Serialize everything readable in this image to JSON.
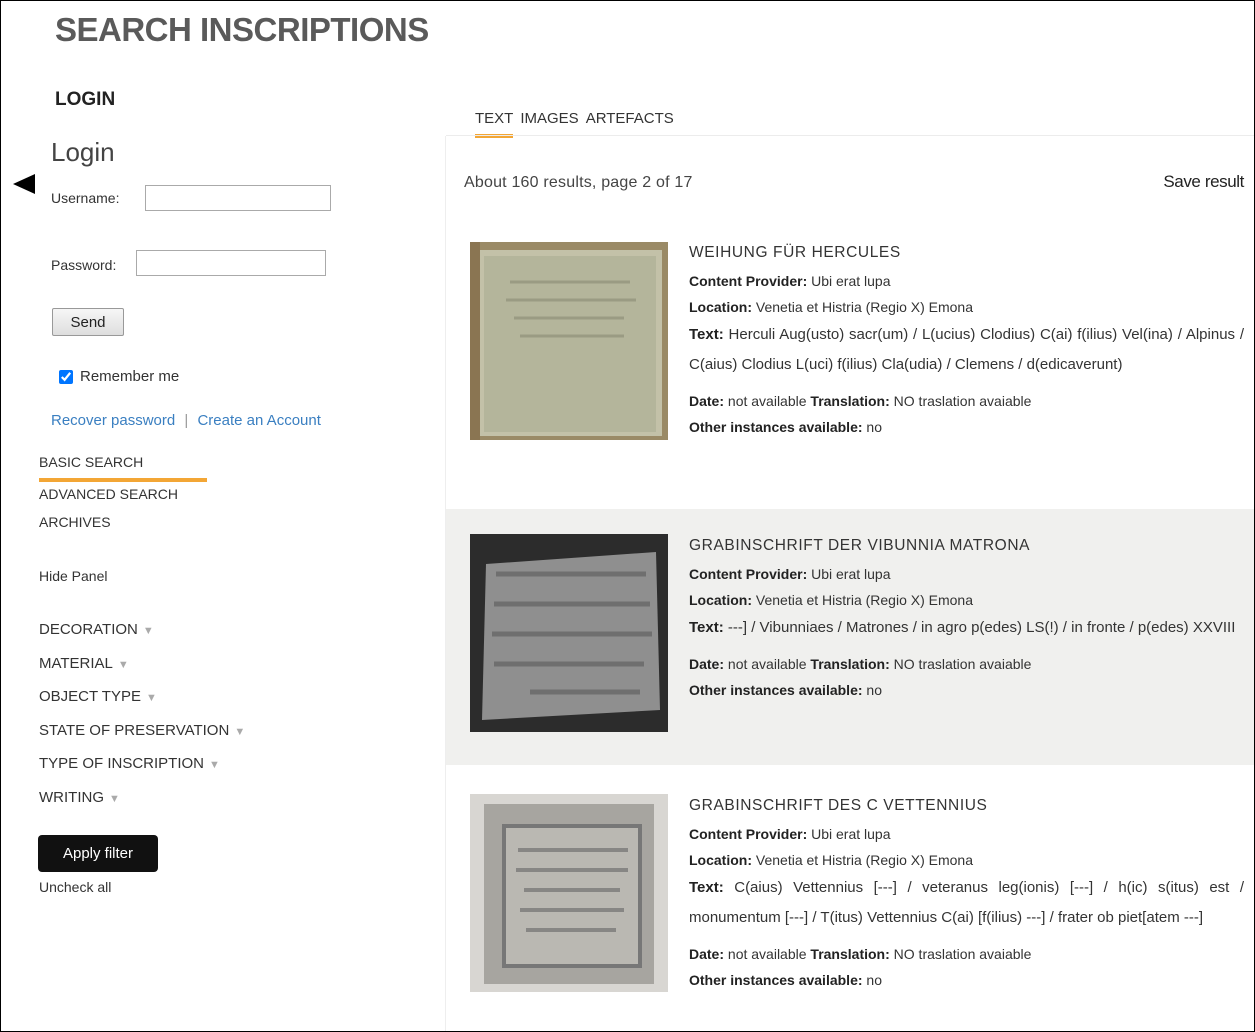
{
  "page": {
    "title": "SEARCH INSCRIPTIONS"
  },
  "login": {
    "heading": "LOGIN",
    "title": "Login",
    "username_label": "Username:",
    "username_value": "",
    "password_label": "Password:",
    "password_value": "",
    "send_label": "Send",
    "remember_label": "Remember me",
    "remember_checked": true,
    "recover_label": "Recover password",
    "separator": "|",
    "create_label": "Create an Account"
  },
  "nav": {
    "basic": "BASIC SEARCH",
    "advanced": "ADVANCED SEARCH",
    "archives": "ARCHIVES",
    "hide_panel": "Hide Panel"
  },
  "filters": {
    "items": [
      "DECORATION",
      "MATERIAL",
      "OBJECT TYPE",
      "STATE OF PRESERVATION",
      "TYPE OF INSCRIPTION",
      "WRITING"
    ],
    "apply_label": "Apply filter",
    "uncheck_label": "Uncheck all"
  },
  "tabs": [
    "TEXT",
    "IMAGES",
    "ARTEFACTS"
  ],
  "results_info": {
    "summary": "About 160 results, page 2 of 17",
    "save_label": "Save result"
  },
  "labels": {
    "provider": "Content Provider:",
    "location": "Location:",
    "text": "Text:",
    "date": "Date:",
    "translation": "Translation:",
    "other": "Other instances available:"
  },
  "results": [
    {
      "title": "WEIHUNG FÜR HERCULES",
      "provider": "Ubi erat lupa",
      "location": "Venetia et Histria (Regio X) Emona",
      "text": "Herculi Aug(usto) sacr(um) / L(ucius) Clodius) C(ai) f(ilius) Vel(ina) / Alpinus / C(aius) Clodius L(uci) f(ilius) Cla(udia) / Clemens / d(edicaverunt)",
      "date": "not available",
      "translation": "NO traslation avaiable",
      "other": "no"
    },
    {
      "title": "GRABINSCHRIFT DER VIBUNNIA MATRONA",
      "provider": "Ubi erat lupa",
      "location": "Venetia et Histria (Regio X) Emona",
      "text": "---] / Vibunniaes / Matrones / in agro p(edes) LS(!) / in fronte / p(edes) XXVIII",
      "date": "not available",
      "translation": "NO traslation avaiable",
      "other": "no"
    },
    {
      "title": "GRABINSCHRIFT DES C VETTENNIUS",
      "provider": "Ubi erat lupa",
      "location": "Venetia et Histria (Regio X) Emona",
      "text": "C(aius) Vettennius [---] / veteranus leg(ionis) [---] / h(ic) s(itus) est / monumentum [---] / T(itus) Vettennius C(ai) [f(ilius) ---] / frater ob piet[atem ---]",
      "date": "not available",
      "translation": "NO traslation avaiable",
      "other": "no"
    }
  ]
}
